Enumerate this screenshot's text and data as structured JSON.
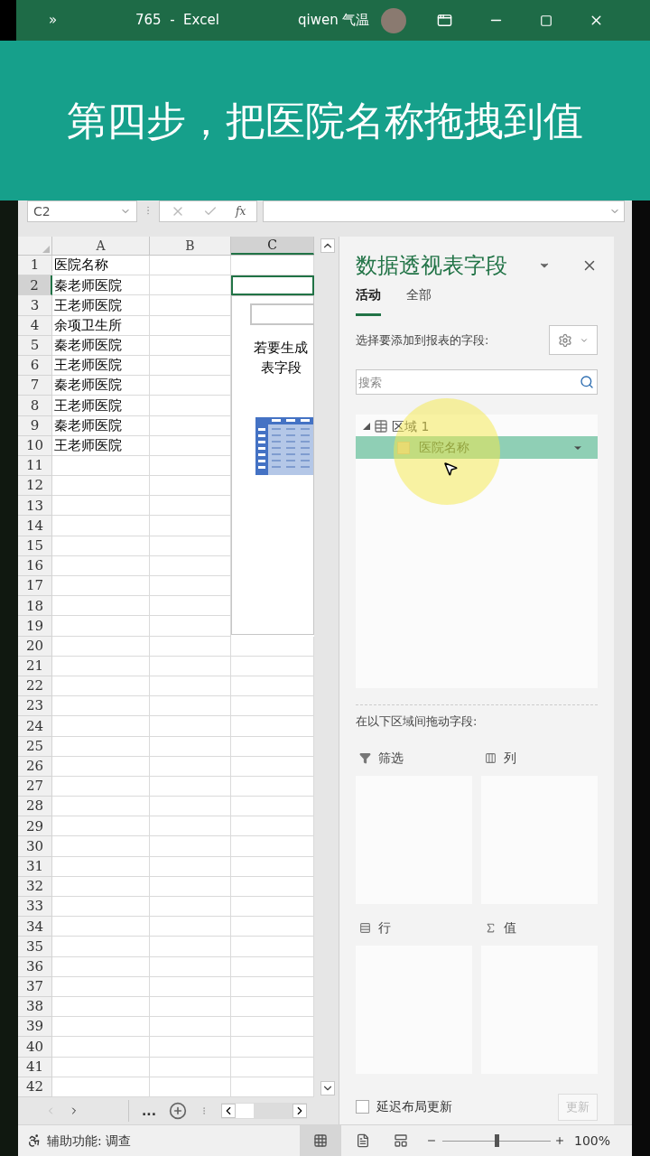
{
  "title_bar": {
    "chevron": "»",
    "title": "765  -  Excel",
    "user": "qiwen 气温"
  },
  "banner": {
    "text": "第四步，把医院名称拖拽到值"
  },
  "formula_bar": {
    "name_box": "C2",
    "function_label": "fx"
  },
  "sheet": {
    "columns": [
      {
        "label": "A",
        "selected": false
      },
      {
        "label": "B",
        "selected": false
      },
      {
        "label": "C",
        "selected": true
      }
    ],
    "rows": [
      {
        "number": "1",
        "selected": false,
        "cells": [
          "医院名称"
        ]
      },
      {
        "number": "2",
        "selected": true,
        "cells": [
          "秦老师医院"
        ]
      },
      {
        "number": "3",
        "selected": false,
        "cells": [
          "王老师医院"
        ]
      },
      {
        "number": "4",
        "selected": false,
        "cells": [
          "余项卫生所"
        ]
      },
      {
        "number": "5",
        "selected": false,
        "cells": [
          "秦老师医院"
        ]
      },
      {
        "number": "6",
        "selected": false,
        "cells": [
          "王老师医院"
        ]
      },
      {
        "number": "7",
        "selected": false,
        "cells": [
          "秦老师医院"
        ]
      },
      {
        "number": "8",
        "selected": false,
        "cells": [
          "王老师医院"
        ]
      },
      {
        "number": "9",
        "selected": false,
        "cells": [
          "秦老师医院"
        ]
      },
      {
        "number": "10",
        "selected": false,
        "cells": [
          "王老师医院"
        ]
      },
      {
        "number": "11",
        "selected": false,
        "cells": []
      },
      {
        "number": "12",
        "selected": false,
        "cells": []
      },
      {
        "number": "13",
        "selected": false,
        "cells": []
      },
      {
        "number": "14",
        "selected": false,
        "cells": []
      },
      {
        "number": "15",
        "selected": false,
        "cells": []
      },
      {
        "number": "16",
        "selected": false,
        "cells": []
      },
      {
        "number": "17",
        "selected": false,
        "cells": []
      },
      {
        "number": "18",
        "selected": false,
        "cells": []
      },
      {
        "number": "19",
        "selected": false,
        "cells": []
      },
      {
        "number": "20",
        "selected": false,
        "cells": []
      },
      {
        "number": "21",
        "selected": false,
        "cells": []
      },
      {
        "number": "22",
        "selected": false,
        "cells": []
      },
      {
        "number": "23",
        "selected": false,
        "cells": []
      },
      {
        "number": "24",
        "selected": false,
        "cells": []
      },
      {
        "number": "25",
        "selected": false,
        "cells": []
      },
      {
        "number": "26",
        "selected": false,
        "cells": []
      },
      {
        "number": "27",
        "selected": false,
        "cells": []
      },
      {
        "number": "28",
        "selected": false,
        "cells": []
      },
      {
        "number": "29",
        "selected": false,
        "cells": []
      },
      {
        "number": "30",
        "selected": false,
        "cells": []
      },
      {
        "number": "31",
        "selected": false,
        "cells": []
      },
      {
        "number": "32",
        "selected": false,
        "cells": []
      },
      {
        "number": "33",
        "selected": false,
        "cells": []
      },
      {
        "number": "34",
        "selected": false,
        "cells": []
      },
      {
        "number": "35",
        "selected": false,
        "cells": []
      },
      {
        "number": "36",
        "selected": false,
        "cells": []
      },
      {
        "number": "37",
        "selected": false,
        "cells": []
      },
      {
        "number": "38",
        "selected": false,
        "cells": []
      },
      {
        "number": "39",
        "selected": false,
        "cells": []
      },
      {
        "number": "40",
        "selected": false,
        "cells": []
      },
      {
        "number": "41",
        "selected": false,
        "cells": []
      },
      {
        "number": "42",
        "selected": false,
        "cells": []
      }
    ],
    "pivot_placeholder": {
      "lines": [
        "若要生成",
        "表字段"
      ]
    }
  },
  "sheet_tabs": {
    "more": "..."
  },
  "pane": {
    "title": "数据透视表字段",
    "tabs": [
      {
        "label": "活动",
        "selected": true
      },
      {
        "label": "全部",
        "selected": false
      }
    ],
    "prompt": "选择要添加到报表的字段:",
    "search": {
      "placeholder": "搜索"
    },
    "fields": [
      {
        "label": "区域 1",
        "expanded": true,
        "children": [
          {
            "label": "医院名称",
            "checked": false,
            "selected": true
          }
        ]
      }
    ],
    "areas_prompt": "在以下区域间拖动字段:",
    "areas": [
      {
        "kind": "filter",
        "label": "筛选"
      },
      {
        "kind": "columns",
        "label": "列"
      },
      {
        "kind": "rows",
        "label": "行"
      },
      {
        "kind": "values",
        "label": "值"
      }
    ],
    "defer": {
      "label": "延迟布局更新",
      "checked": false
    },
    "update_button": "更新"
  },
  "status_bar": {
    "accessibility": "辅助功能: 调查",
    "zoom": {
      "level": 0.5,
      "reading": "100%"
    }
  }
}
